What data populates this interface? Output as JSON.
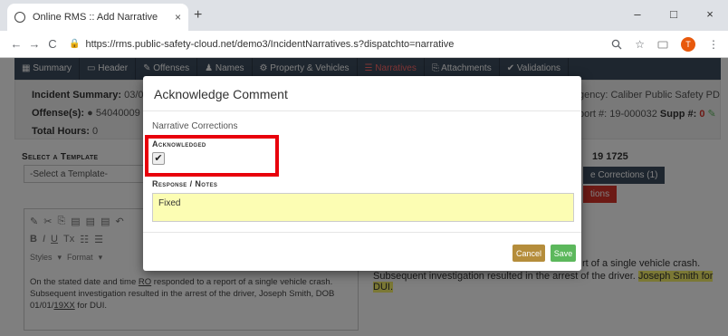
{
  "browser": {
    "tab_title": "Online RMS :: Add Narrative",
    "tab_close": "×",
    "new_tab": "+",
    "window_controls": [
      "–",
      "□",
      "×"
    ],
    "nav": {
      "back": "←",
      "forward": "→",
      "reload": "C"
    },
    "url": "https://rms.public-safety-cloud.net/demo3/IncidentNarratives.s?dispatchto=narrative",
    "profile_initial": "T"
  },
  "app": {
    "nav_tabs": [
      "Summary",
      "Header",
      "Offenses",
      "Names",
      "Property & Vehicles",
      "Narratives",
      "Attachments",
      "Validations"
    ],
    "summary": {
      "incident_label": "Incident Summary:",
      "incident_value": "03/07/2",
      "offenses_label": "Offense(s):",
      "offenses_value": "54040009 - D",
      "total_hours_label": "Total Hours:",
      "total_hours_value": "0",
      "agency_fragment": "gency: Caliber Public Safety PD",
      "report_fragment": "port #: 19-000032",
      "supp_label": "Supp #:",
      "supp_value": "0"
    },
    "template": {
      "section_title": "Select a Template",
      "select_value": "-Select a Template-"
    },
    "editor": {
      "styles_label": "Styles",
      "format_label": "Format",
      "text_prefix": "On the stated date and time ",
      "text_ro": "RO",
      "text_mid": " responded to a report of a single vehicle crash. Subsequent investigation resulted in the arrest of the driver, Joseph Smith, DOB 01/01/",
      "text_year": "19XX",
      "text_suffix": " for DUI."
    },
    "right": {
      "date_fragment": "19 1725",
      "corrections_button": "e Corrections (1)",
      "red_button": "tions",
      "text_line1": "rt of a single vehicle crash.",
      "text_line2_prefix": "Subsequent investigation resulted in the arrest of the driver. ",
      "text_line2_highlight": "Joseph Smith for DUI."
    }
  },
  "modal": {
    "title": "Acknowledge Comment",
    "subtitle": "Narrative Corrections",
    "ack_label": "Acknowledged",
    "ack_checked": true,
    "ack_mark": "✔",
    "notes_label": "Response / Notes",
    "notes_value": "Fixed",
    "cancel_label": "Cancel",
    "save_label": "Save"
  },
  "colors": {
    "nav_bg": "#3d4c5e",
    "highlight_box": "#e8000b",
    "notes_bg": "#fcfdb3",
    "cancel_bg": "#b58d3b",
    "save_bg": "#5cb85c"
  }
}
